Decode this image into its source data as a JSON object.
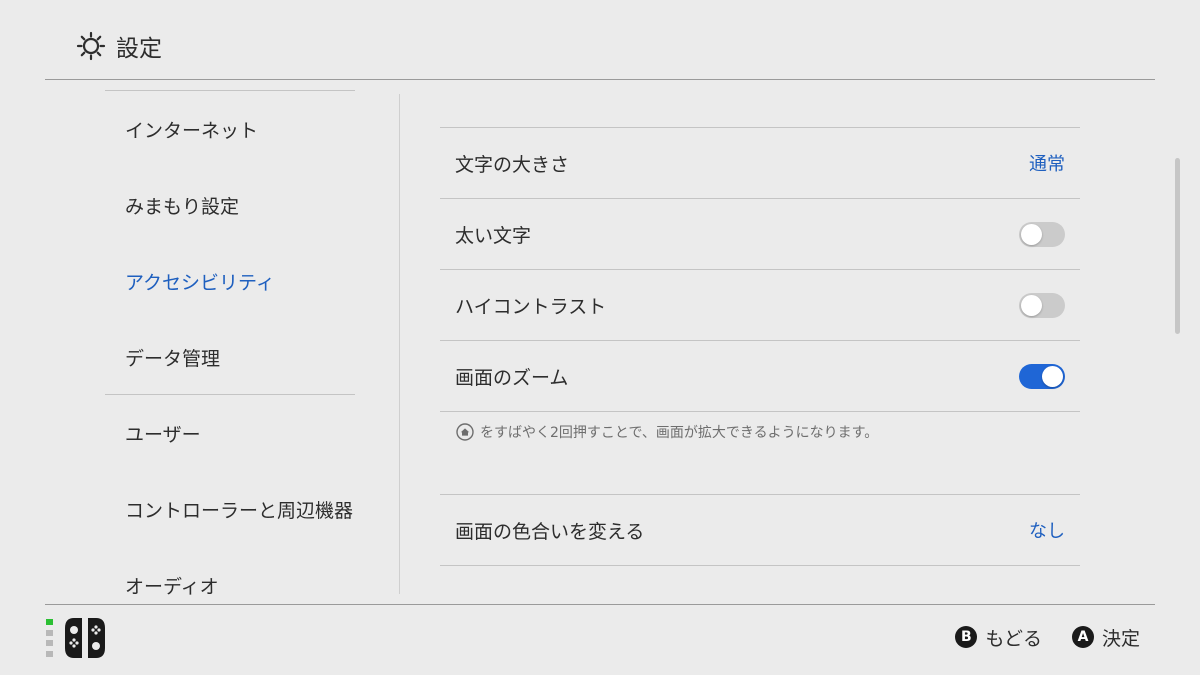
{
  "header": {
    "title": "設定",
    "icon": "gear-icon"
  },
  "sidebar": {
    "items": [
      {
        "label": "インターネット",
        "active": false
      },
      {
        "label": "みまもり設定",
        "active": false
      },
      {
        "label": "アクセシビリティ",
        "active": true
      },
      {
        "label": "データ管理",
        "active": false
      },
      {
        "label": "ユーザー",
        "active": false
      },
      {
        "label": "コントローラーと周辺機器",
        "active": false
      },
      {
        "label": "オーディオ",
        "active": false
      }
    ]
  },
  "settings": {
    "text_size": {
      "label": "文字の大きさ",
      "value": "通常"
    },
    "bold_text": {
      "label": "太い文字",
      "enabled": false
    },
    "high_contrast": {
      "label": "ハイコントラスト",
      "enabled": false
    },
    "screen_zoom": {
      "label": "画面のズーム",
      "enabled": true
    },
    "zoom_note": "をすばやく2回押すことで、画面が拡大できるようになります。",
    "color_change": {
      "label": "画面の色合いを変える",
      "value": "なし"
    }
  },
  "footer": {
    "battery_levels": 4,
    "back": {
      "button": "B",
      "label": "もどる"
    },
    "confirm": {
      "button": "A",
      "label": "決定"
    }
  },
  "colors": {
    "accent": "#1e5fbf",
    "toggle_on": "#1f66d6",
    "background": "#ebebeb",
    "battery_green": "#2bbf33"
  }
}
